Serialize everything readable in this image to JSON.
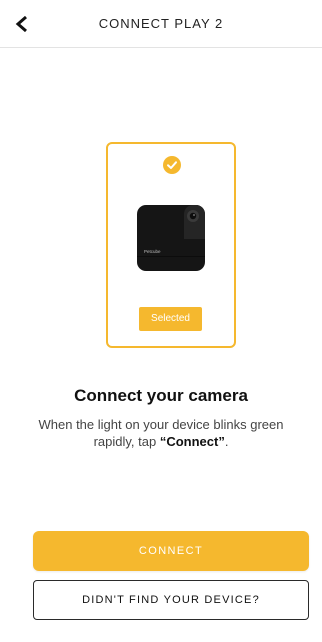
{
  "header": {
    "title": "CONNECT PLAY 2",
    "back_icon": "chevron-left-icon"
  },
  "device_card": {
    "check_icon": "check-circle-icon",
    "brand_text": "Petcube",
    "selected_label": "Selected"
  },
  "main": {
    "title": "Connect your camera",
    "instruction_prefix": "When the light on your device blinks green rapidly, tap ",
    "instruction_bold": "“Connect”",
    "instruction_suffix": "."
  },
  "actions": {
    "connect_label": "CONNECT",
    "not_found_label": "DIDN'T FIND YOUR DEVICE?"
  },
  "colors": {
    "accent": "#f5b82e",
    "text": "#111111",
    "border": "#2a2a2a"
  }
}
